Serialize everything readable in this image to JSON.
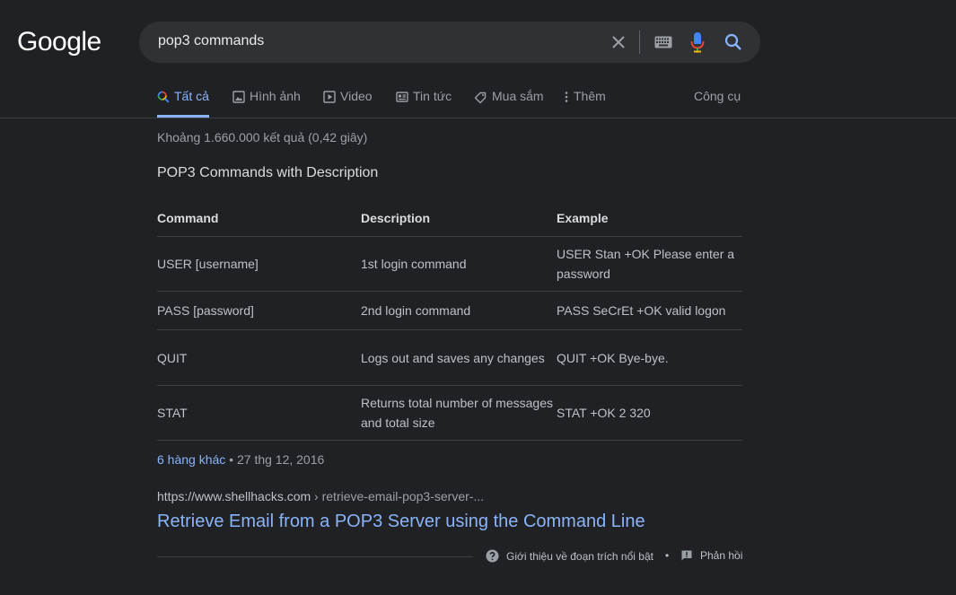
{
  "logo": {
    "text": "Google"
  },
  "search": {
    "query": "pop3 commands"
  },
  "tabs": [
    {
      "label": "Tất cả",
      "icon": "search-icon",
      "active": true
    },
    {
      "label": "Hình ảnh",
      "icon": "image-icon"
    },
    {
      "label": "Video",
      "icon": "video-icon"
    },
    {
      "label": "Tin tức",
      "icon": "news-icon"
    },
    {
      "label": "Mua sắm",
      "icon": "tag-icon"
    },
    {
      "label": "Thêm",
      "icon": "more-vert-icon"
    }
  ],
  "tools_label": "Công cụ",
  "stats": "Khoảng 1.660.000 kết quả (0,42 giây)",
  "snippet": {
    "title": "POP3 Commands with Description",
    "headers": [
      "Command",
      "Description",
      "Example"
    ],
    "rows": [
      [
        "USER [username]",
        "1st login command",
        "USER Stan +OK Please enter a password"
      ],
      [
        "PASS [password]",
        "2nd login command",
        "PASS SeCrEt +OK valid logon"
      ],
      [
        "QUIT",
        "Logs out and saves any changes",
        "QUIT +OK Bye-bye."
      ],
      [
        "STAT",
        "Returns total number of messages and total size",
        "STAT +OK 2 320"
      ]
    ],
    "more_rows_link": "6 hàng khác",
    "date": " • 27 thg 12, 2016"
  },
  "result": {
    "cite_domain": "https://www.shellhacks.com",
    "cite_path": " › retrieve-email-pop3-server-...",
    "title": "Retrieve Email from a POP3 Server using the Command Line"
  },
  "footer": {
    "about_label": "Giới thiệu về đoạn trích nổi bật",
    "separator": "•",
    "feedback_label": "Phản hồi"
  },
  "colors": {
    "background": "#202124",
    "link": "#8ab4f8",
    "search_box": "#303134"
  }
}
